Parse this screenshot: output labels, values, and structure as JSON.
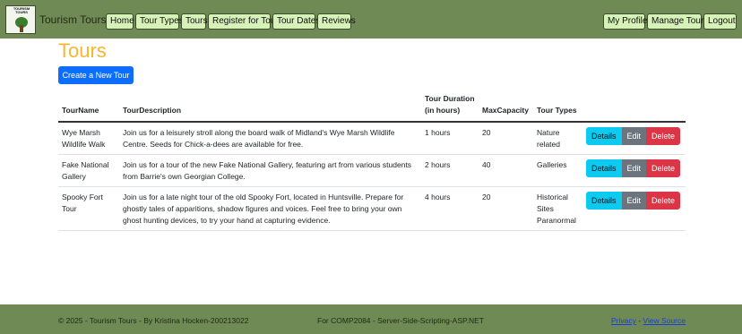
{
  "header": {
    "logo_text": "TOURISM TOURS",
    "brand": "Tourism Tours",
    "nav": [
      "Home",
      "Tour Types",
      "Tours",
      "Register for Tour",
      "Tour Dates",
      "Reviews"
    ],
    "right_nav": [
      "My Profile",
      "Manage Tours",
      "Logout"
    ]
  },
  "main": {
    "title": "Tours",
    "create_label": "Create a New Tour",
    "columns": [
      "TourName",
      "TourDescription",
      "Tour Duration (in hours)",
      "MaxCapacity",
      "Tour Types"
    ],
    "rows": [
      {
        "name": "Wye Marsh Wildlife Walk",
        "description": "Join us for a leisurely stroll along the board walk of Midland's Wye Marsh Wildlife Centre. Seeds for Chick-a-dees are available for free.",
        "duration": "1 hours",
        "capacity": "20",
        "types": "Nature related"
      },
      {
        "name": "Fake National Gallery",
        "description": "Join us for a tour of the new Fake National Gallery, featuring art from various students from Barrie's own Georgian College.",
        "duration": "2 hours",
        "capacity": "40",
        "types": "Galleries"
      },
      {
        "name": "Spooky Fort Tour",
        "description": "Join us for a late night tour of the old Spooky Fort, located in Huntsville. Prepare for ghostly tales of apparitions, shadow figures and voices. Feel free to bring your own ghost hunting devices, to try your hand at capturing evidence.",
        "duration": "4 hours",
        "capacity": "20",
        "types": "Historical Sites Paranormal"
      }
    ],
    "actions": {
      "details": "Details",
      "edit": "Edit",
      "delete": "Delete"
    }
  },
  "footer": {
    "copyright": "© 2025 - Tourism Tours - By Kristina Hocken-200213022",
    "course": "For COMP2084 - Server-Side-Scripting-ASP.NET",
    "privacy": "Privacy",
    "separator": " - ",
    "source": "View Source"
  },
  "colors": {
    "nav_bg": "#6f8a54",
    "nav_button": "#d6f2b8",
    "title": "#f5b731",
    "primary": "#0d6efd",
    "info": "#0dcaf0",
    "secondary": "#6c757d",
    "danger": "#dc3545"
  }
}
